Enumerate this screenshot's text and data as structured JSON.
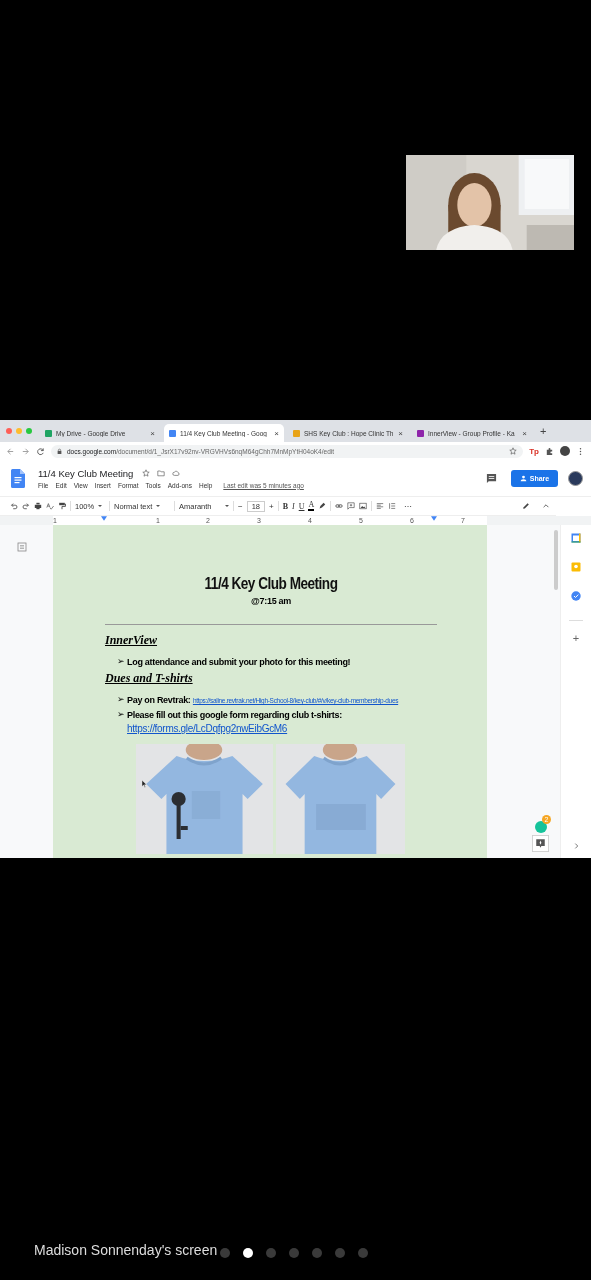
{
  "browser": {
    "tabs": [
      {
        "title": "My Drive - Google Drive",
        "selected": false
      },
      {
        "title": "11/4 Key Club Meeting - Goog",
        "selected": true
      },
      {
        "title": "SHS Key Club : Hope Clinic Th",
        "selected": false
      },
      {
        "title": "InnerView - Group Profile - Ka",
        "selected": false
      }
    ],
    "close_mark": "×",
    "new_tab": "+",
    "url_host": "docs.google.com",
    "url_path": "/document/d/1_JsrX17v92nv-VRGVHVs6nqM64gChh7MnMpYtH04oK4/edit",
    "extension_badge": "Tp"
  },
  "docs": {
    "title": "11/4 Key Club Meeting",
    "menu": [
      "File",
      "Edit",
      "View",
      "Insert",
      "Format",
      "Tools",
      "Add-ons",
      "Help"
    ],
    "last_edit": "Last edit was 5 minutes ago",
    "share": "Share",
    "toolbar": {
      "zoom": "100%",
      "style": "Normal text",
      "font": "Amaranth",
      "minus": "−",
      "size": "18",
      "plus": "+",
      "format_buttons": [
        "B",
        "I",
        "U",
        "A"
      ],
      "more": "⋯"
    },
    "ruler_numbers": [
      "1",
      "1",
      "2",
      "3",
      "4",
      "5",
      "6",
      "7"
    ]
  },
  "document": {
    "title": "11/4 Key Club Meeting",
    "subtitle": "@7:15 am",
    "sections": [
      {
        "heading": "InnerView",
        "bullets": [
          {
            "marker": "➢",
            "text": "Log attendance and submit your photo for this meeting!"
          }
        ]
      },
      {
        "heading": "Dues and T-shirts",
        "bullets": [
          {
            "marker": "➢",
            "text": "Pay on Revtrak:",
            "link": "https://saline.revtrak.net/High-School-8/key-club/#/v/key-club-membership-dues",
            "kind": "inline_link"
          },
          {
            "marker": "➢",
            "text": "Please fill out this google form regarding club t-shirts:",
            "link": "https://forms.gle/LcDqfpg2nwEibGcM6",
            "kind": "block_link"
          }
        ]
      }
    ]
  },
  "grammarly_badge": "2",
  "share_label": "Madison Sonnenday's screen",
  "pages": [
    {
      "selected": false
    },
    {
      "selected": true
    },
    {
      "selected": false
    },
    {
      "selected": false
    },
    {
      "selected": false
    },
    {
      "selected": false
    },
    {
      "selected": false
    }
  ]
}
